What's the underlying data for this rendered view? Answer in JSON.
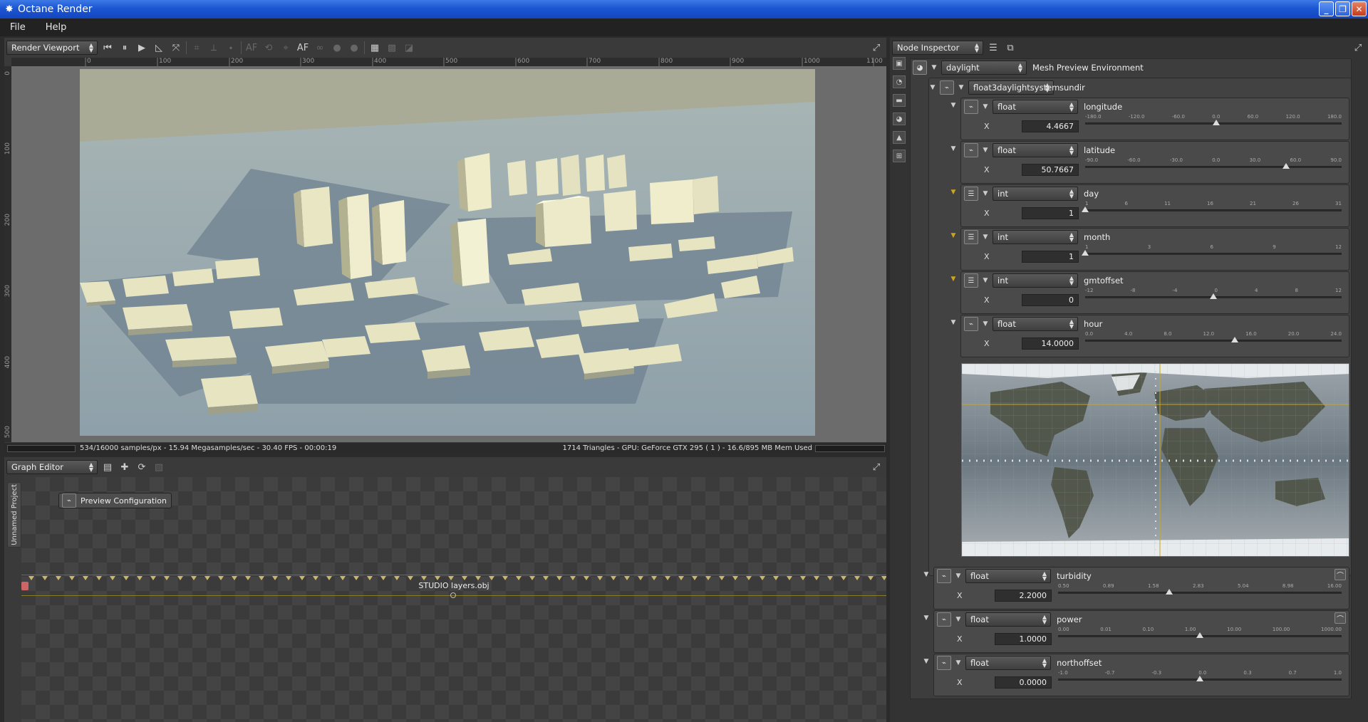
{
  "window": {
    "title": "Octane Render"
  },
  "menu": [
    "File",
    "Help"
  ],
  "viewport": {
    "combo": "Render Viewport",
    "ruler_h": [
      "0",
      "100",
      "200",
      "300",
      "400",
      "500",
      "600",
      "700",
      "800",
      "900",
      "1000",
      "1100"
    ],
    "ruler_v": [
      "0",
      "100",
      "200",
      "300",
      "400",
      "500"
    ],
    "status_left": "534/16000 samples/px - 15.94 Megasamples/sec - 30.40 FPS - 00:00:19",
    "status_right": "1714 Triangles - GPU: GeForce GTX 295 ( 1 ) - 16.6/895 MB Mem Used"
  },
  "graph_editor": {
    "combo": "Graph Editor",
    "project_tab": "Unnamed Project",
    "node_preview": "Preview Configuration",
    "node_obj": "STUDIO layers.obj"
  },
  "inspector": {
    "combo": "Node Inspector",
    "root": {
      "type": "daylight",
      "name": "Mesh Preview Environment"
    },
    "sundir": {
      "type": "float3daylightsystem",
      "name": "sundir"
    },
    "params": [
      {
        "type": "float",
        "name": "longitude",
        "value": "4.4667",
        "ticks": [
          "-180.0",
          "-120.0",
          "-60.0",
          "0.0",
          "60.0",
          "120.0",
          "180.0"
        ],
        "pos": 0.512
      },
      {
        "type": "float",
        "name": "latitude",
        "value": "50.7667",
        "ticks": [
          "-90.0",
          "-60.0",
          "-30.0",
          "0.0",
          "30.0",
          "60.0",
          "90.0"
        ],
        "pos": 0.782
      },
      {
        "type": "int",
        "name": "day",
        "value": "1",
        "ticks": [
          "1",
          "6",
          "11",
          "16",
          "21",
          "26",
          "31"
        ],
        "pos": 0.0
      },
      {
        "type": "int",
        "name": "month",
        "value": "1",
        "ticks": [
          "1",
          "3",
          "6",
          "9",
          "12"
        ],
        "pos": 0.0
      },
      {
        "type": "int",
        "name": "gmtoffset",
        "value": "0",
        "ticks": [
          "-12",
          "-8",
          "-4",
          "0",
          "4",
          "8",
          "12"
        ],
        "pos": 0.5
      },
      {
        "type": "float",
        "name": "hour",
        "value": "14.0000",
        "ticks": [
          "0.0",
          "4.0",
          "8.0",
          "12.0",
          "16.0",
          "20.0",
          "24.0"
        ],
        "pos": 0.583
      }
    ],
    "lower": [
      {
        "type": "float",
        "name": "turbidity",
        "value": "2.2000",
        "ticks": [
          "0.50",
          "0.89",
          "1.58",
          "2.83",
          "5.04",
          "8.98",
          "16.00"
        ],
        "pos": 0.392
      },
      {
        "type": "float",
        "name": "power",
        "value": "1.0000",
        "ticks": [
          "0.00",
          "0.01",
          "0.10",
          "1.00",
          "10.00",
          "100.00",
          "1000.00"
        ],
        "pos": 0.5
      },
      {
        "type": "float",
        "name": "northoffset",
        "value": "0.0000",
        "ticks": [
          "-1.0",
          "-0.7",
          "-0.3",
          "0.0",
          "0.3",
          "0.7",
          "1.0"
        ],
        "pos": 0.5
      }
    ]
  }
}
